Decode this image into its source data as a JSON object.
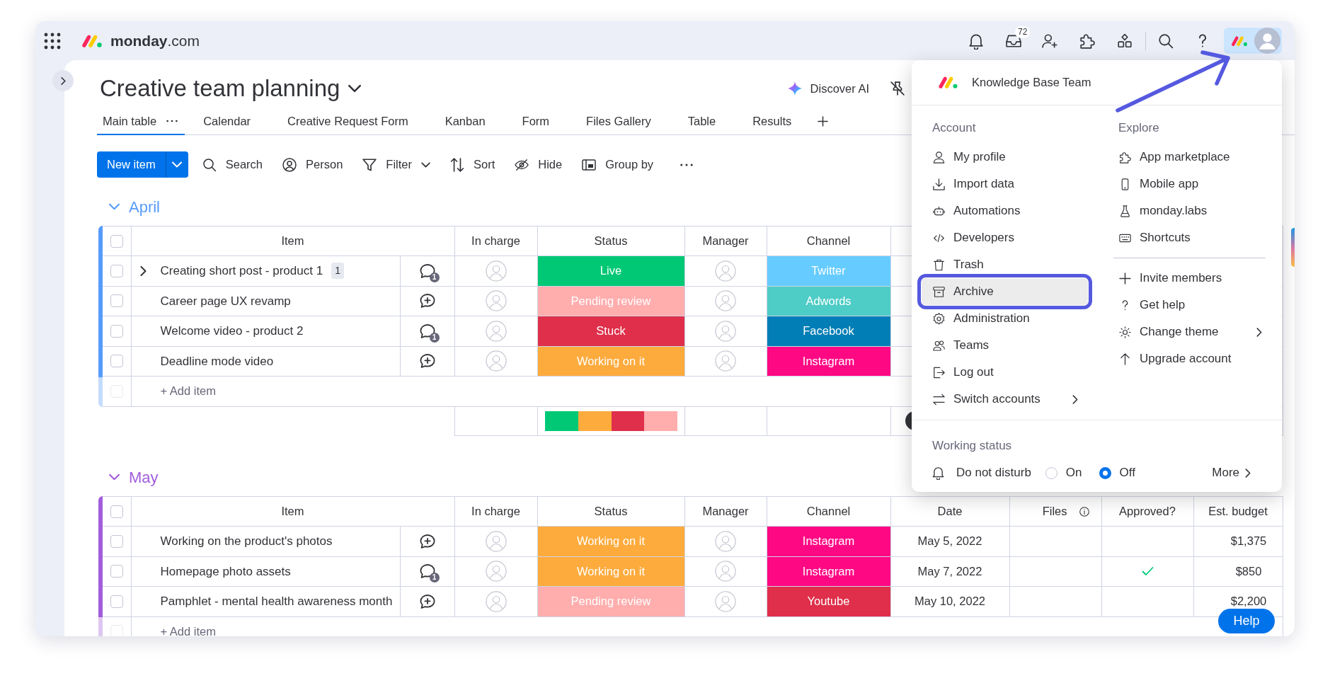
{
  "topbar": {
    "brand": "**monday**.com",
    "inbox_count": "72"
  },
  "board": {
    "title": "Creative team planning",
    "discover_ai": "Discover AI"
  },
  "views": [
    {
      "label": "Main table",
      "selected": true
    },
    {
      "label": "Calendar",
      "selected": false
    },
    {
      "label": "Creative Request Form",
      "selected": false
    },
    {
      "label": "Kanban",
      "selected": false
    },
    {
      "label": "Form",
      "selected": false
    },
    {
      "label": "Files Gallery",
      "selected": false
    },
    {
      "label": "Table",
      "selected": false
    },
    {
      "label": "Results",
      "selected": false
    }
  ],
  "toolbar": {
    "new_item": "New item",
    "actions": [
      {
        "label": "Search",
        "has_menu": false
      },
      {
        "label": "Person",
        "has_menu": false
      },
      {
        "label": "Filter",
        "has_menu": true
      },
      {
        "label": "Sort",
        "has_menu": false
      },
      {
        "label": "Hide",
        "has_menu": false
      },
      {
        "label": "Group by",
        "has_menu": false
      }
    ]
  },
  "groups": [
    {
      "title": "April",
      "color": "#579bfc",
      "expanded": true,
      "all_checked": false,
      "columns": [
        "Item",
        "In charge",
        "Status",
        "Manager",
        "Channel"
      ],
      "rows": [
        {
          "checked": false,
          "item": "Creating short post - product 1",
          "subitems": "1",
          "expanded": false,
          "updates": "1",
          "status": {
            "label": "Live",
            "color": "#00c875"
          },
          "channel": {
            "label": "Twitter",
            "color": "#66ccff"
          }
        },
        {
          "checked": false,
          "item": "Career page UX revamp",
          "status": {
            "label": "Pending review",
            "color": "#ffadad"
          },
          "channel": {
            "label": "Adwords",
            "color": "#4eccc6"
          }
        },
        {
          "checked": false,
          "item": "Welcome video - product 2",
          "updates": "1",
          "status": {
            "label": "Stuck",
            "color": "#df2f4a"
          },
          "channel": {
            "label": "Facebook",
            "color": "#007eb5"
          }
        },
        {
          "checked": false,
          "item": "Deadline mode video",
          "status": {
            "label": "Working on it",
            "color": "#fdab3d"
          },
          "channel": {
            "label": "Instagram",
            "color": "#ff0884"
          }
        }
      ],
      "add_item": "+ Add item",
      "add_checkbox_disabled": true,
      "summary": [
        {
          "color": "#00c875"
        },
        {
          "color": "#fdab3d"
        },
        {
          "color": "#df2f4a"
        },
        {
          "color": "#ffadad"
        }
      ]
    },
    {
      "title": "May",
      "color": "#a25ddc",
      "expanded": true,
      "all_checked": false,
      "columns": [
        "Item",
        "In charge",
        "Status",
        "Manager",
        "Channel",
        "Date",
        "Files",
        "Approved?",
        "Est. budget"
      ],
      "rows": [
        {
          "checked": false,
          "item": "Working on the product's photos",
          "status": {
            "label": "Working on it",
            "color": "#fdab3d"
          },
          "channel": {
            "label": "Instagram",
            "color": "#ff0884"
          },
          "date": "May 5, 2022",
          "approved": false,
          "budget": "$1,375"
        },
        {
          "checked": false,
          "item": "Homepage photo assets",
          "updates": "1",
          "status": {
            "label": "Working on it",
            "color": "#fdab3d"
          },
          "channel": {
            "label": "Instagram",
            "color": "#ff0884"
          },
          "date": "May 7, 2022",
          "approved": true,
          "budget": "$850"
        },
        {
          "checked": false,
          "item": "Pamphlet - mental health awareness month",
          "status": {
            "label": "Pending review",
            "color": "#ffadad"
          },
          "channel": {
            "label": "Youtube",
            "color": "#df2f4a"
          },
          "date": "May 10, 2022",
          "approved": false,
          "budget": "$2,200"
        }
      ],
      "add_item": "+ Add item",
      "add_checkbox_disabled": true
    }
  ],
  "account_menu": {
    "team": "Knowledge Base Team",
    "account": {
      "heading": "Account",
      "items": [
        {
          "label": "My profile",
          "highlighted": false,
          "submenu": false
        },
        {
          "label": "Import data",
          "highlighted": false,
          "submenu": false
        },
        {
          "label": "Automations",
          "highlighted": false,
          "submenu": false
        },
        {
          "label": "Developers",
          "highlighted": false,
          "submenu": false
        },
        {
          "label": "Trash",
          "highlighted": false,
          "submenu": false
        },
        {
          "label": "Archive",
          "highlighted": true,
          "submenu": false
        },
        {
          "label": "Administration",
          "highlighted": false,
          "submenu": false
        },
        {
          "label": "Teams",
          "highlighted": false,
          "submenu": false
        },
        {
          "label": "Log out",
          "highlighted": false,
          "submenu": false
        },
        {
          "label": "Switch accounts",
          "highlighted": false,
          "submenu": true
        }
      ]
    },
    "explore": {
      "heading": "Explore",
      "items": [
        {
          "label": "App marketplace",
          "highlighted": false,
          "submenu": false
        },
        {
          "label": "Mobile app",
          "highlighted": false,
          "submenu": false
        },
        {
          "label": "monday.labs",
          "highlighted": false,
          "submenu": false
        },
        {
          "label": "Shortcuts",
          "highlighted": false,
          "submenu": false
        }
      ],
      "more_items": [
        {
          "label": "Invite members",
          "highlighted": false,
          "submenu": false
        },
        {
          "label": "Get help",
          "highlighted": false,
          "submenu": false
        },
        {
          "label": "Change theme",
          "highlighted": false,
          "submenu": true
        },
        {
          "label": "Upgrade account",
          "highlighted": false,
          "submenu": false
        }
      ]
    },
    "working_status": {
      "heading": "Working status",
      "label": "Do not disturb",
      "options": [
        {
          "label": "On",
          "selected": false
        },
        {
          "label": "Off",
          "selected": true
        }
      ],
      "more": "More"
    }
  },
  "help": "Help"
}
